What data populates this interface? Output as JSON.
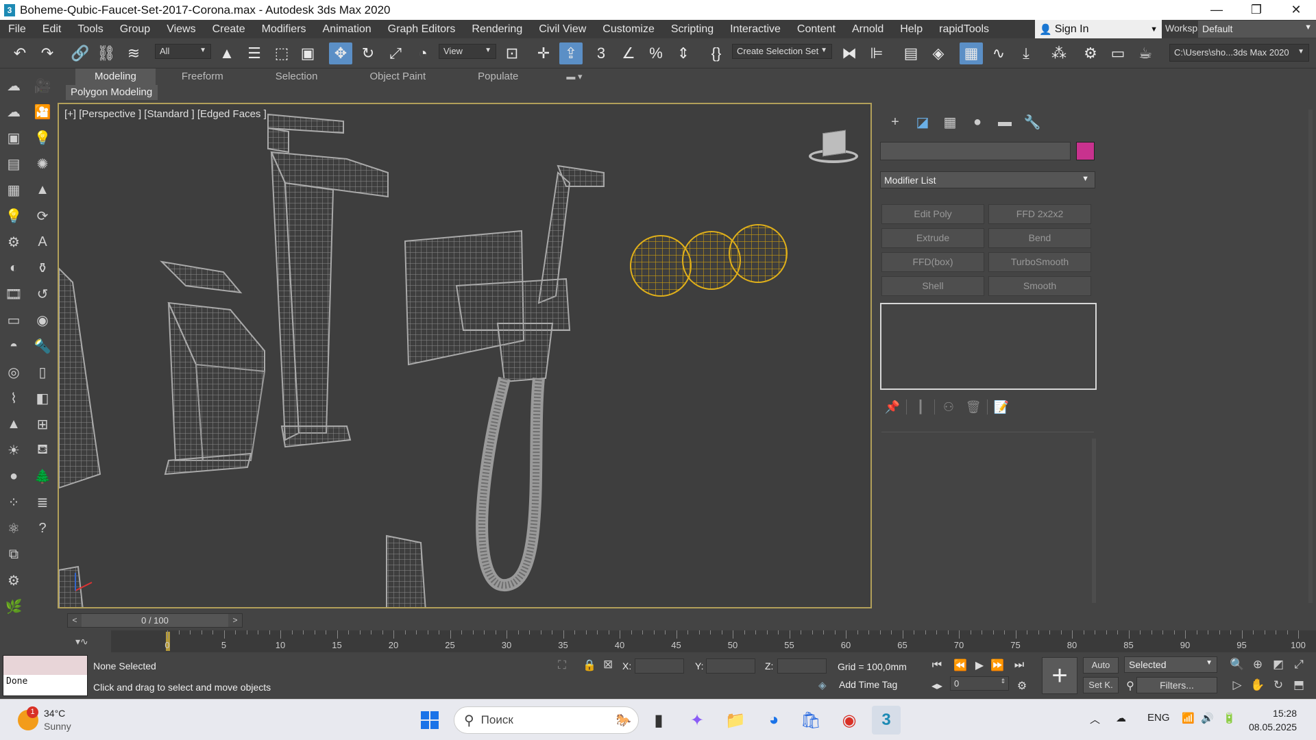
{
  "window": {
    "title": "Boheme-Qubic-Faucet-Set-2017-Corona.max - Autodesk 3ds Max 2020",
    "minimize": "—",
    "restore": "❐",
    "close": "✕"
  },
  "menubar": {
    "items": [
      "File",
      "Edit",
      "Tools",
      "Group",
      "Views",
      "Create",
      "Modifiers",
      "Animation",
      "Graph Editors",
      "Rendering",
      "Civil View",
      "Customize",
      "Scripting",
      "Interactive",
      "Content",
      "Arnold",
      "Help",
      "rapidTools"
    ],
    "sign_in": "Sign In",
    "workspaces_label": "Workspaces:",
    "workspace_value": "Default"
  },
  "toolbar": {
    "selection_filter": "All",
    "ref_coord": "View",
    "selection_set": "Create Selection Set",
    "project_path": "C:\\Users\\sho...3ds Max 2020"
  },
  "ribbon": {
    "tabs": [
      "Modeling",
      "Freeform",
      "Selection",
      "Object Paint",
      "Populate"
    ],
    "active_tab": "Modeling",
    "sub_label": "Polygon Modeling"
  },
  "viewport": {
    "label": "[+] [Perspective ] [Standard ] [Edged Faces ]"
  },
  "command_panel": {
    "modifier_list": "Modifier List",
    "color_swatch": "#c8328e",
    "modifier_buttons": [
      "Edit Poly",
      "FFD 2x2x2",
      "Extrude",
      "Bend",
      "FFD(box)",
      "TurboSmooth",
      "Shell",
      "Smooth"
    ]
  },
  "timeline": {
    "slider_text": "0 / 100",
    "prev": "<",
    "next": ">",
    "ticks": [
      "0",
      "5",
      "10",
      "15",
      "20",
      "25",
      "30",
      "35",
      "40",
      "45",
      "50",
      "55",
      "60",
      "65",
      "70",
      "75",
      "80",
      "85",
      "90",
      "95",
      "100"
    ]
  },
  "status": {
    "maxscript_text": "Done",
    "selection_status": "None Selected",
    "prompt": "Click and drag to select and move objects",
    "x_label": "X:",
    "y_label": "Y:",
    "z_label": "Z:",
    "grid": "Grid = 100,0mm",
    "add_time_tag": "Add Time Tag",
    "frame_value": "0",
    "auto_btn": "Auto",
    "setk_btn": "Set K.",
    "key_mode": "Selected",
    "filters_btn": "Filters..."
  },
  "taskbar": {
    "temperature": "34°C",
    "weather": "Sunny",
    "weather_badge": "1",
    "search_placeholder": "Поиск",
    "language": "ENG",
    "time": "15:28",
    "date": "08.05.2025"
  }
}
